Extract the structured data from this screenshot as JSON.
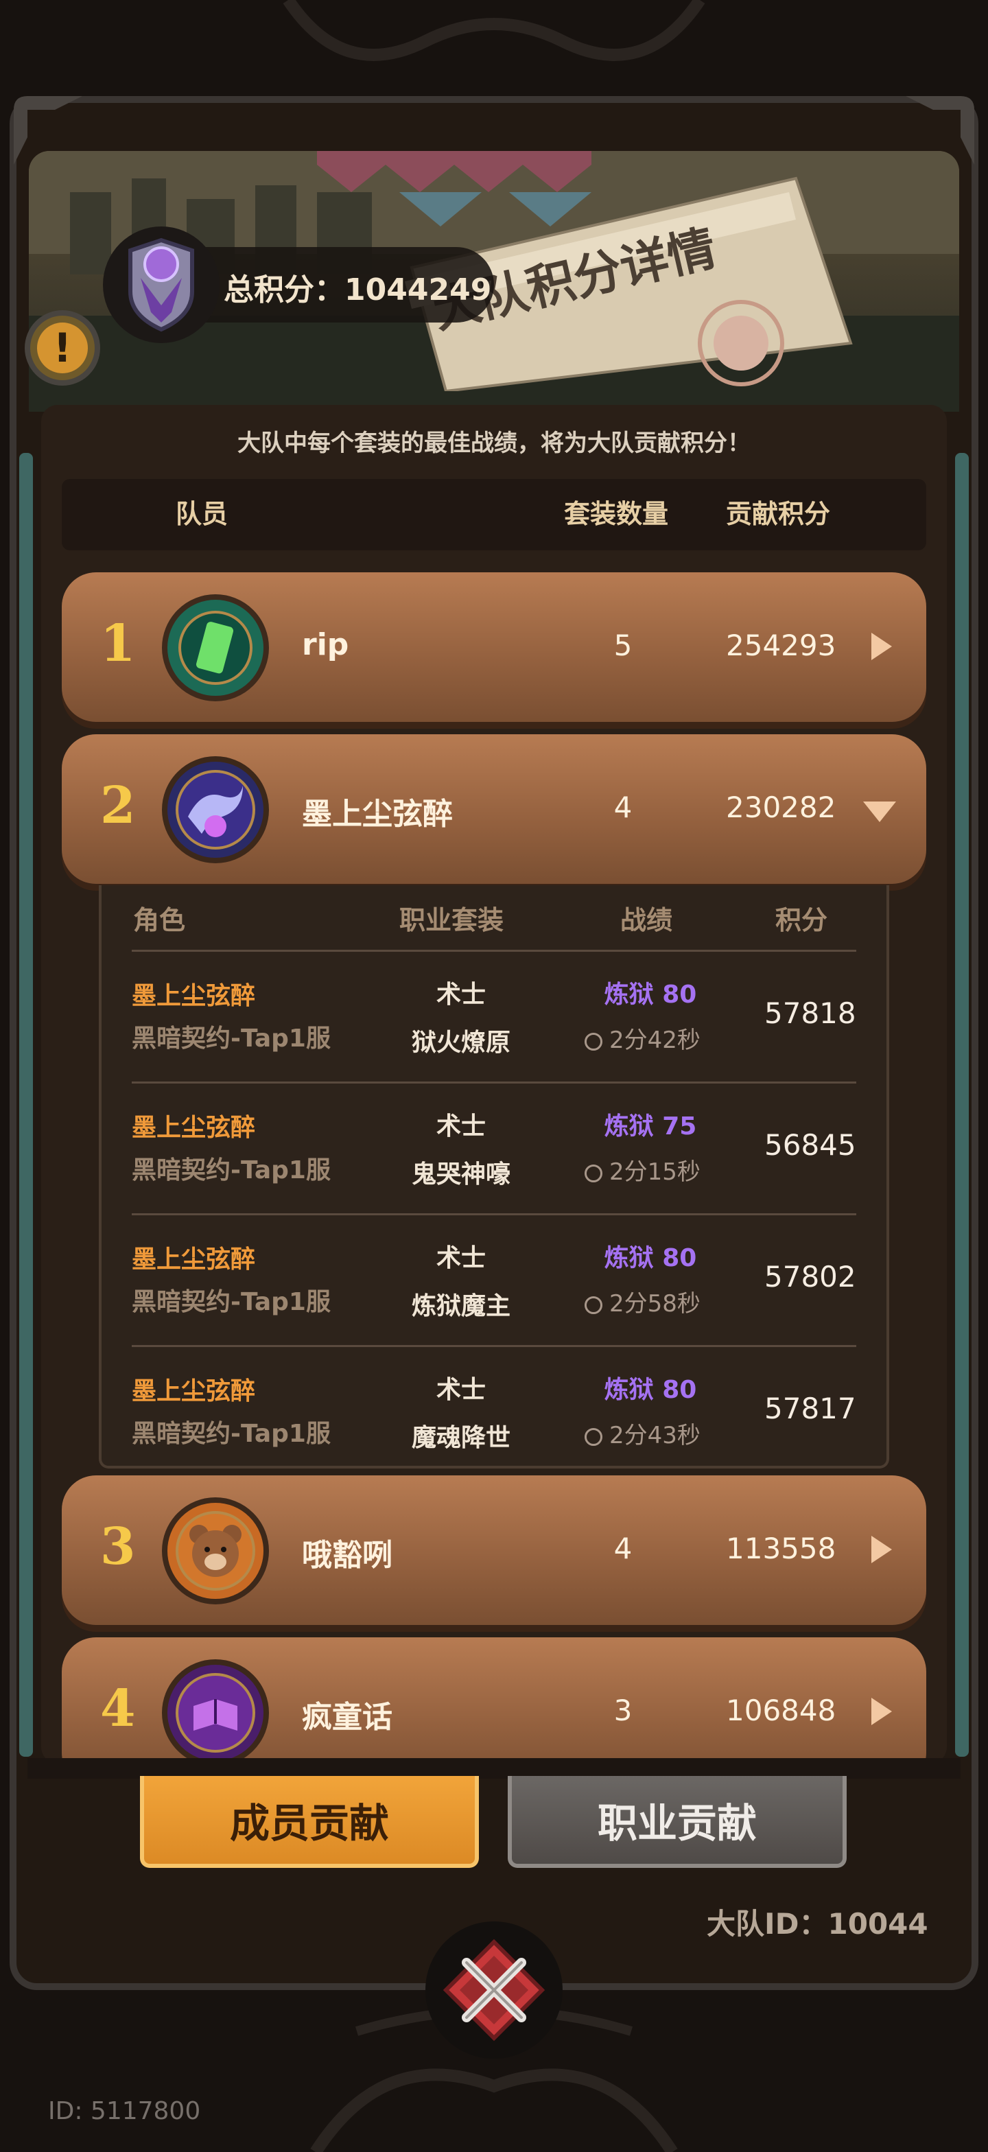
{
  "total_score": {
    "label": "总积分：1044249"
  },
  "page_title": "大队积分详情",
  "subtitle": "大队中每个套装的最佳战绩，将为大队贡献积分！",
  "table_header": {
    "member": "队员",
    "set_count": "套装数量",
    "contribution": "贡献积分"
  },
  "members": [
    {
      "rank": "1",
      "name": "rip",
      "sets": "5",
      "score": "254293",
      "expanded": false
    },
    {
      "rank": "2",
      "name": "墨上尘弦醉",
      "sets": "4",
      "score": "230282",
      "expanded": true
    },
    {
      "rank": "3",
      "name": "哦豁咧",
      "sets": "4",
      "score": "113558",
      "expanded": false
    },
    {
      "rank": "4",
      "name": "疯童话",
      "sets": "3",
      "score": "106848",
      "expanded": false
    }
  ],
  "detail_header": {
    "role": "角色",
    "class_set": "职业套装",
    "record": "战绩",
    "points": "积分"
  },
  "detail_rows": [
    {
      "name": "墨上尘弦醉",
      "server": "黑暗契约-Tap1服",
      "class": "术士",
      "set": "狱火燎原",
      "level": "炼狱 80",
      "time": "2分42秒",
      "points": "57818"
    },
    {
      "name": "墨上尘弦醉",
      "server": "黑暗契约-Tap1服",
      "class": "术士",
      "set": "鬼哭神嚎",
      "level": "炼狱 75",
      "time": "2分15秒",
      "points": "56845"
    },
    {
      "name": "墨上尘弦醉",
      "server": "黑暗契约-Tap1服",
      "class": "术士",
      "set": "炼狱魔主",
      "level": "炼狱 80",
      "time": "2分58秒",
      "points": "57802"
    },
    {
      "name": "墨上尘弦醉",
      "server": "黑暗契约-Tap1服",
      "class": "术士",
      "set": "魔魂降世",
      "level": "炼狱 80",
      "time": "2分43秒",
      "points": "57817"
    }
  ],
  "tabs": {
    "member_contribution": "成员贡献",
    "class_contribution": "职业贡献"
  },
  "team_id": "大队ID：10044",
  "user_id": "ID: 5117800",
  "colors": {
    "accent": "#f09a3a",
    "record": "#a572f2",
    "rank": "#f6c94a",
    "row": "#9a6442"
  },
  "icons": {
    "emblem": "purple-gem-shield-icon",
    "info": "exclamation-icon",
    "close": "crossed-swords-icon"
  }
}
